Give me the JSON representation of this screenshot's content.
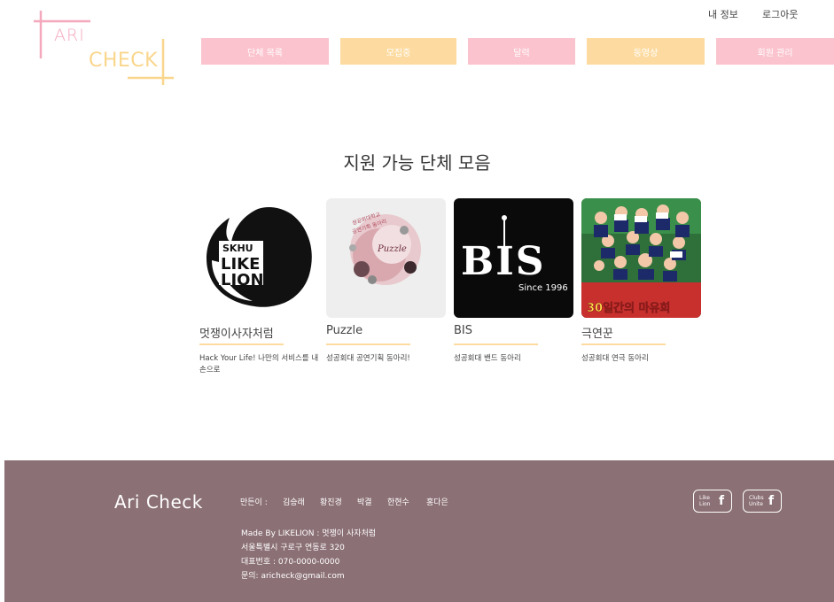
{
  "logo": {
    "line1": "ARI",
    "line2": "CHECK"
  },
  "util_links": {
    "my_info": "내 정보",
    "logout": "로그아웃"
  },
  "nav": [
    {
      "label": "단체 목록"
    },
    {
      "label": "모집중"
    },
    {
      "label": "달력"
    },
    {
      "label": "동영상"
    },
    {
      "label": "회원 관리"
    }
  ],
  "section_title": "지원 가능 단체 모음",
  "clubs": [
    {
      "name": "멋쟁이사자처럼",
      "desc": "Hack Your Life! 나만의 서비스를 내손으로",
      "logo_text": [
        "SKHU",
        "LIKE",
        "LION"
      ]
    },
    {
      "name": "Puzzle",
      "desc": "성공회대 공연기획 동아리!",
      "logo_text": [
        "성공회대학교",
        "공연기획 동아리",
        "Puzzle"
      ]
    },
    {
      "name": "BIS",
      "desc": "성공회대 밴드 동아리",
      "logo_text": [
        "BIS",
        "Since 1996"
      ]
    },
    {
      "name": "극연꾼",
      "desc": "성공회대 연극 동아리",
      "logo_text": [
        "30일간의 마유희"
      ]
    }
  ],
  "footer": {
    "brand": "Ari Check",
    "makers_label": "만든이 :",
    "makers": [
      "김승래",
      "황진경",
      "박결",
      "한현수",
      "홍다은"
    ],
    "info": [
      "Made By LIKELION : 멋쟁이 사자처럼",
      "서울특별시 구로구 연동로 320",
      "대표번호 : 070-0000-0000",
      "문의: aricheck@gmail.com"
    ],
    "badges": [
      {
        "text": "Like Lion",
        "icon": "facebook-icon"
      },
      {
        "text": "Clubs Unite",
        "icon": "facebook-icon"
      }
    ]
  },
  "colors": {
    "pink": "#fbc3cd",
    "yellow": "#fddba0",
    "footer_bg": "#8b7075"
  }
}
